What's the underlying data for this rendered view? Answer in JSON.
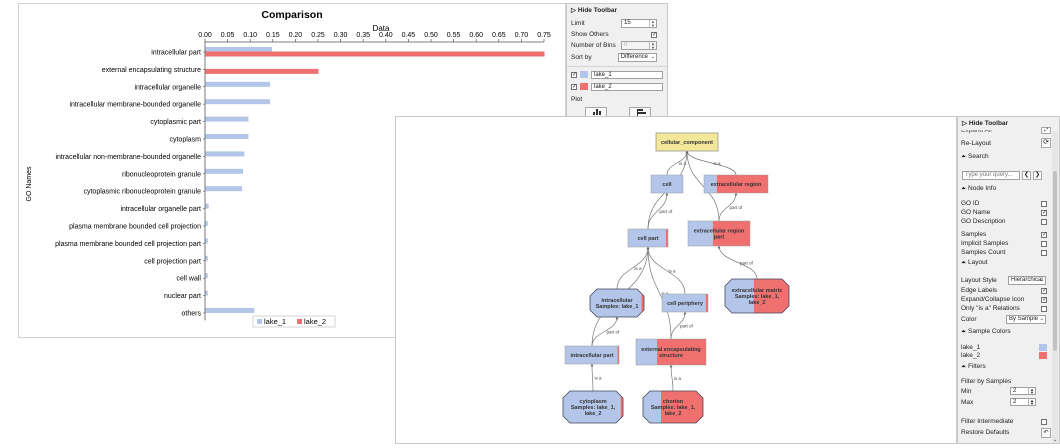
{
  "chart_data": {
    "type": "bar",
    "orientation": "horizontal",
    "title": "Comparison",
    "xlabel": "Data",
    "ylabel": "GO Names",
    "xlim": [
      0,
      0.75
    ],
    "xticks": [
      "0.00",
      "0.05",
      "0.10",
      "0.15",
      "0.20",
      "0.25",
      "0.30",
      "0.35",
      "0.40",
      "0.45",
      "0.50",
      "0.55",
      "0.60",
      "0.65",
      "0.70",
      "0.75"
    ],
    "categories": [
      "intracellular part",
      "external encapsulating structure",
      "intracellular organelle",
      "intracellular membrane-bounded organelle",
      "cytoplasmic part",
      "cytoplasm",
      "intracellular non-membrane-bounded organelle",
      "ribonucleoprotein granule",
      "cytoplasmic ribonucleoprotein granule",
      "intracellular organelle part",
      "plasma membrane bounded cell projection",
      "plasma membrane bounded cell projection part",
      "cell projection part",
      "cell wall",
      "nuclear part",
      "others"
    ],
    "series": [
      {
        "name": "lake_1",
        "color": "#b3c6ea",
        "values": [
          0.147,
          0.0,
          0.143,
          0.143,
          0.095,
          0.095,
          0.086,
          0.083,
          0.081,
          0.007,
          0.005,
          0.005,
          0.005,
          0.005,
          0.005,
          0.108
        ]
      },
      {
        "name": "lake_2",
        "color": "#f07070",
        "values": [
          0.75,
          0.25,
          0,
          0,
          0,
          0,
          0,
          0,
          0,
          0,
          0,
          0,
          0,
          0,
          0,
          0
        ]
      }
    ],
    "grid": false,
    "legend_position": "bottom"
  },
  "toolbar1": {
    "hide_label": "Hide Toolbar",
    "limit_label": "Limit",
    "limit_value": "15",
    "show_others_label": "Show Others",
    "show_others_checked": true,
    "bins_label": "Number of Bins",
    "bins_value": "0",
    "sort_label": "Sort by",
    "sort_value": "Difference",
    "samples": [
      {
        "name": "lake_1",
        "color": "#b3c6ea",
        "checked": true
      },
      {
        "name": "lake_2",
        "color": "#f07070",
        "checked": true
      }
    ],
    "plot_label": "Plot"
  },
  "graph": {
    "nodes": [
      {
        "id": "cellular_component",
        "label": "cellular_component",
        "lines": [
          "cellular_component"
        ],
        "type": "root"
      },
      {
        "id": "cell",
        "lines": [
          "cell"
        ],
        "fill": [
          1,
          0
        ]
      },
      {
        "id": "extracellular_region",
        "lines": [
          "extracellular region"
        ],
        "fill": [
          0.2,
          0.8
        ]
      },
      {
        "id": "extracellular_region_part",
        "lines": [
          "extracellular region",
          "part"
        ],
        "fill": [
          0.4,
          0.6
        ]
      },
      {
        "id": "cell_part",
        "lines": [
          "cell part"
        ],
        "fill": [
          0.95,
          0.05
        ]
      },
      {
        "id": "intracellular",
        "lines": [
          "intracellular",
          "Samples: lake_1"
        ],
        "fill": [
          0.95,
          0.05
        ],
        "shape": "oct"
      },
      {
        "id": "cell_periphery",
        "lines": [
          "cell periphery"
        ],
        "fill": [
          0.95,
          0.05
        ]
      },
      {
        "id": "extracellular_matrix",
        "lines": [
          "extracellular matrix",
          "Samples: lake_1,",
          "lake_2"
        ],
        "fill": [
          0.45,
          0.55
        ],
        "shape": "oct"
      },
      {
        "id": "intracellular_part",
        "lines": [
          "intracellular part"
        ],
        "fill": [
          0.97,
          0.03
        ]
      },
      {
        "id": "external_encapsulating",
        "lines": [
          "external encapsulating",
          "structure"
        ],
        "fill": [
          0.3,
          0.7
        ]
      },
      {
        "id": "cytoplasm",
        "lines": [
          "cytoplasm",
          "Samples: lake_1,",
          "lake_2"
        ],
        "fill": [
          0.96,
          0.04
        ],
        "shape": "oct"
      },
      {
        "id": "chorion",
        "lines": [
          "chorion",
          "Samples: lake_1,",
          "lake_2"
        ],
        "fill": [
          0.3,
          0.7
        ],
        "shape": "oct"
      }
    ],
    "edges": [
      {
        "from": "cell",
        "to": "cellular_component",
        "label": "is a"
      },
      {
        "from": "extracellular_region",
        "to": "cellular_component",
        "label": "is a"
      },
      {
        "from": "cell_part",
        "to": "cell",
        "label": "part of"
      },
      {
        "from": "extracellular_region_part",
        "to": "extracellular_region",
        "label": "part of"
      },
      {
        "from": "cell_part",
        "to": "cellular_component",
        "label": "is a"
      },
      {
        "from": "extracellular_region_part",
        "to": "cellular_component",
        "label": "is a"
      },
      {
        "from": "intracellular",
        "to": "cell_part",
        "label": "is a"
      },
      {
        "from": "cell_periphery",
        "to": "cell_part",
        "label": "is a"
      },
      {
        "from": "intracellular_part",
        "to": "cell_part",
        "label": "is a"
      },
      {
        "from": "external_encapsulating",
        "to": "cell_part",
        "label": "is a"
      },
      {
        "from": "extracellular_matrix",
        "to": "extracellular_region_part",
        "label": "part of"
      },
      {
        "from": "intracellular_part",
        "to": "intracellular",
        "label": "part of"
      },
      {
        "from": "external_encapsulating",
        "to": "cell_periphery",
        "label": "part of"
      },
      {
        "from": "cytoplasm",
        "to": "intracellular_part",
        "label": "is a"
      },
      {
        "from": "chorion",
        "to": "external_encapsulating",
        "label": "is a"
      }
    ]
  },
  "toolbar2": {
    "hide_label": "Hide Toolbar",
    "expand_all_label": "Expand All",
    "relayout_label": "Re-Layout",
    "search_section": "Search",
    "search_placeholder": "Type your query...",
    "node_info_section": "Node Info",
    "go_id_label": "GO ID",
    "go_name_label": "GO Name",
    "go_desc_label": "GO Description",
    "samples_label": "Samples",
    "implicit_label": "Implicit Samples",
    "samples_count_label": "Samples Count",
    "layout_section": "Layout",
    "layout_style_label": "Layout Style",
    "layout_style_value": "Hierarchical",
    "edge_labels_label": "Edge Labels",
    "expand_icon_label": "Expand/Collapse Icon",
    "only_isa_label": "Only \"is a\" Relations",
    "color_label": "Color",
    "color_value": "By Sample",
    "sample_colors_section": "Sample Colors",
    "sample_colors": [
      {
        "name": "lake_1",
        "color": "#b3c6ea"
      },
      {
        "name": "lake_2",
        "color": "#f07070"
      }
    ],
    "filters_section": "Filters",
    "filter_by_samples_label": "Filter by Samples",
    "min_label": "Min",
    "min_value": "2",
    "max_label": "Max",
    "max_value": "2",
    "filter_intermediate_label": "Filter Intermediate",
    "restore_defaults_label": "Restore Defaults"
  }
}
